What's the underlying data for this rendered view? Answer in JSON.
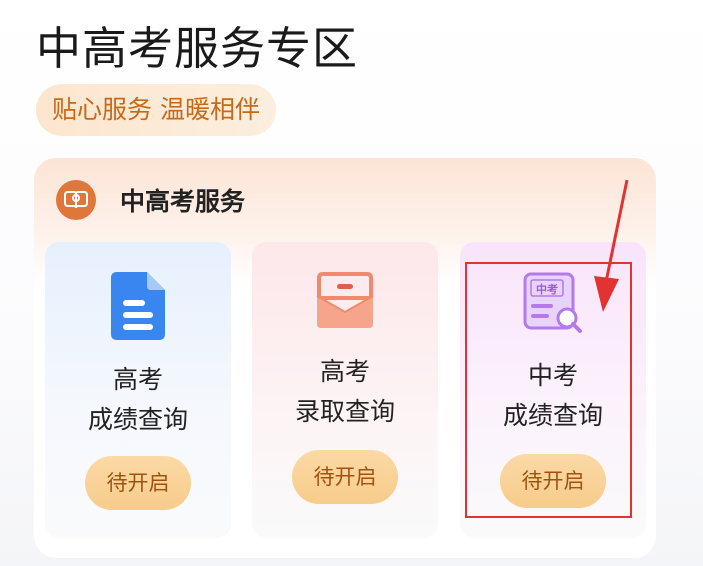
{
  "page": {
    "title": "中高考服务专区",
    "slogan": "贴心服务 温暖相伴"
  },
  "section": {
    "title": "中高考服务",
    "icon": "book-reader-icon"
  },
  "cards": [
    {
      "line1": "高考",
      "line2": "成绩查询",
      "button": "待开启",
      "icon": "document-icon",
      "color": "#3a86f0"
    },
    {
      "line1": "高考",
      "line2": "录取查询",
      "button": "待开启",
      "icon": "envelope-icon",
      "color": "#f08a6a"
    },
    {
      "line1": "中考",
      "line2": "成绩查询",
      "button": "待开启",
      "icon": "exam-search-icon",
      "icon_text": "中考",
      "color": "#b47ae8"
    }
  ],
  "colors": {
    "accent_orange": "#e0773a",
    "button_bg": "#f7cc8b",
    "highlight_red": "#e23232"
  }
}
